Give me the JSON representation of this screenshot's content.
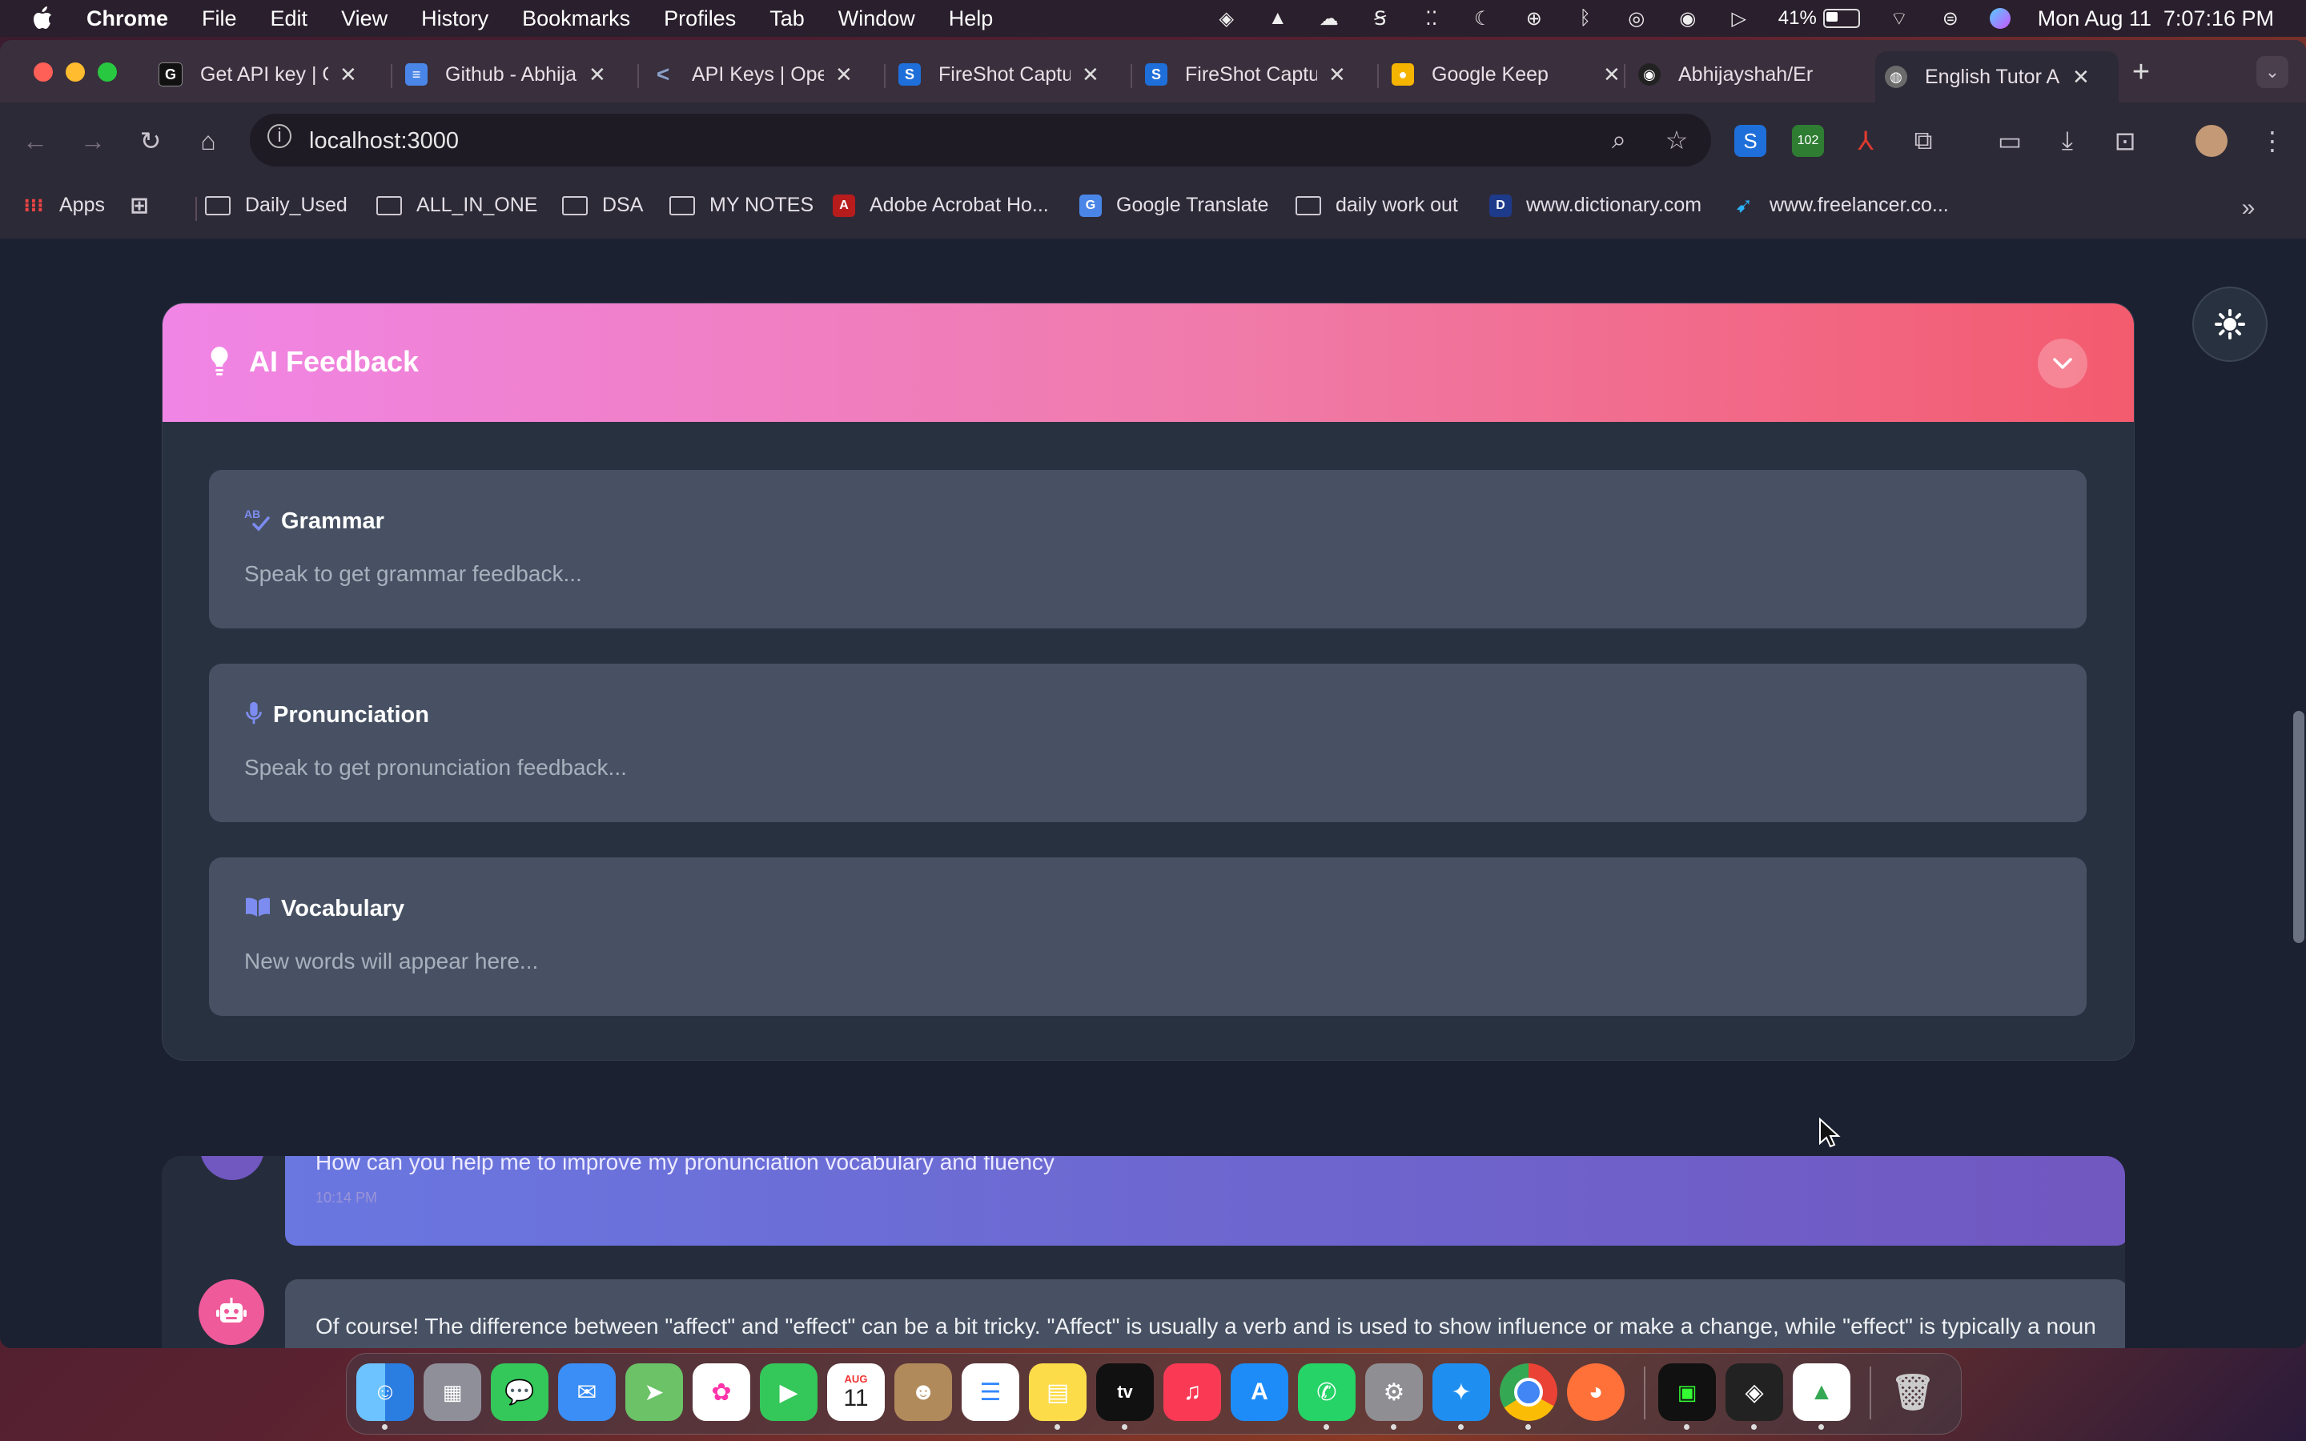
{
  "menubar": {
    "app": "Chrome",
    "items": [
      "File",
      "Edit",
      "View",
      "History",
      "Bookmarks",
      "Profiles",
      "Tab",
      "Window",
      "Help"
    ],
    "battery": "41%",
    "clock": "Mon Aug 11  7:07:16 PM"
  },
  "tabs": [
    {
      "title": "Get API key | G",
      "icon": "api-key-icon",
      "color": "#111111"
    },
    {
      "title": "Github - Abhija",
      "icon": "docs-icon",
      "color": "#4a86e8"
    },
    {
      "title": "API Keys | Ope",
      "icon": "vscode-like-icon",
      "color": "#5b6b8a"
    },
    {
      "title": "FireShot Captu",
      "icon": "fireshot-icon",
      "color": "#1e6fd9"
    },
    {
      "title": "FireShot Captu",
      "icon": "fireshot-icon",
      "color": "#1e6fd9"
    },
    {
      "title": "Google Keep",
      "icon": "keep-icon",
      "color": "#f4b400"
    },
    {
      "title": "Abhijayshah/Er",
      "icon": "github-icon",
      "color": "#222222"
    },
    {
      "title": "English Tutor A",
      "icon": "globe-icon",
      "color": "#6b6b6b"
    }
  ],
  "toolbar": {
    "url": "localhost:3000",
    "extension_badge": "102"
  },
  "bookmarks": [
    {
      "label": "Apps",
      "kind": "apps"
    },
    {
      "label": "",
      "kind": "grid"
    },
    {
      "label": "Daily_Used",
      "kind": "folder"
    },
    {
      "label": "ALL_IN_ONE",
      "kind": "folder"
    },
    {
      "label": "DSA",
      "kind": "folder"
    },
    {
      "label": "MY NOTES",
      "kind": "folder"
    },
    {
      "label": "Adobe Acrobat Ho...",
      "kind": "acrobat"
    },
    {
      "label": "Google Translate",
      "kind": "translate"
    },
    {
      "label": "daily work out",
      "kind": "folder"
    },
    {
      "label": "www.dictionary.com",
      "kind": "dictionary"
    },
    {
      "label": "www.freelancer.co...",
      "kind": "freelancer"
    }
  ],
  "feedback": {
    "title": "AI Feedback",
    "cards": [
      {
        "title": "Grammar",
        "body": "Speak to get grammar feedback...",
        "icon": "spellcheck-icon"
      },
      {
        "title": "Pronunciation",
        "body": "Speak to get pronunciation feedback...",
        "icon": "microphone-icon"
      },
      {
        "title": "Vocabulary",
        "body": "New words will appear here...",
        "icon": "book-icon"
      }
    ]
  },
  "chat": {
    "user_message": "How can you help me to improve my pronunciation vocabulary and fluency",
    "user_time": "10:14 PM",
    "bot_message": "Of course! The difference between \"affect\" and \"effect\" can be a bit tricky. \"Affect\" is usually a verb and is used to show influence or make a change, while \"effect\" is typically a noun and represents the result of that change. Here are some examples: - \"The rain affected my mood.\" (Here, \"affect\" is used as a verb showing how the"
  },
  "dock": {
    "calendar_month": "AUG",
    "calendar_day": "11"
  },
  "colors": {
    "header_gradient_start": "#f085e6",
    "header_gradient_end": "#f35b6e",
    "card_bg": "#475163",
    "panel_bg": "#283140",
    "user_bubble_start": "#6a77e0",
    "user_bubble_end": "#7157c0",
    "bot_avatar": "#ef5a9a"
  }
}
